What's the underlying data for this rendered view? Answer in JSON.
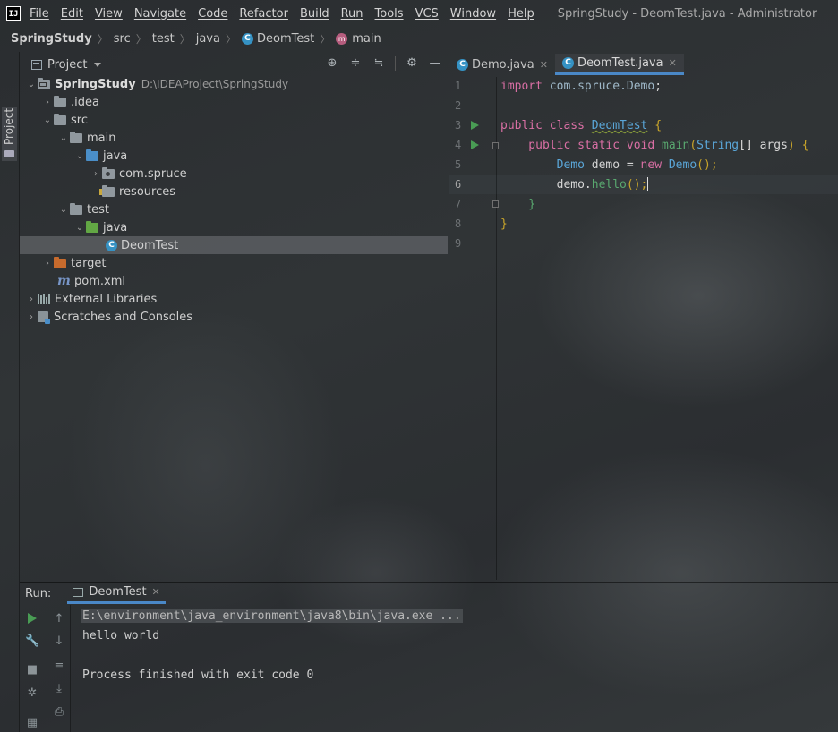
{
  "app": {
    "logo": "IJ",
    "window_title": "SpringStudy - DeomTest.java - Administrator"
  },
  "menu": [
    "File",
    "Edit",
    "View",
    "Navigate",
    "Code",
    "Refactor",
    "Build",
    "Run",
    "Tools",
    "VCS",
    "Window",
    "Help"
  ],
  "breadcrumb": {
    "project": "SpringStudy",
    "parts": [
      "src",
      "test",
      "java"
    ],
    "class": "DeomTest",
    "method": "main"
  },
  "left_stripe": {
    "label": "Project"
  },
  "project_panel": {
    "title": "Project",
    "tree": [
      {
        "label": "SpringStudy",
        "path": "D:\\IDEAProject\\SpringStudy"
      },
      {
        "label": ".idea"
      },
      {
        "label": "src"
      },
      {
        "label": "main"
      },
      {
        "label": "java"
      },
      {
        "label": "com.spruce"
      },
      {
        "label": "resources"
      },
      {
        "label": "test"
      },
      {
        "label": "java"
      },
      {
        "label": "DeomTest"
      },
      {
        "label": "target"
      },
      {
        "label": "pom.xml"
      },
      {
        "label": "External Libraries"
      },
      {
        "label": "Scratches and Consoles"
      }
    ]
  },
  "editor": {
    "tabs": [
      {
        "label": "Demo.java",
        "active": false
      },
      {
        "label": "DeomTest.java",
        "active": true
      }
    ],
    "line_numbers": [
      "1",
      "2",
      "3",
      "4",
      "5",
      "6",
      "7",
      "8",
      "9"
    ],
    "current_line": 6,
    "code": {
      "l1_kw": "import ",
      "l1_pkg": "com.spruce.Demo",
      "l1_semi": ";",
      "l3_kw": "public class ",
      "l3_name": "DeomTest",
      "l3_brace": " {",
      "l4_kw": "    public static void ",
      "l4_fn": "main",
      "l4_paren": "(",
      "l4_type": "String",
      "l4_args": "[] args",
      "l4_close": ") {",
      "l5_type": "        Demo",
      "l5_var": " demo = ",
      "l5_new": "new ",
      "l5_ctor": "Demo",
      "l5_end": "();",
      "l6_var": "        demo.",
      "l6_fn": "hello",
      "l6_end": "();",
      "l7": "    }",
      "l8": "}"
    }
  },
  "run_panel": {
    "label": "Run:",
    "tab": "DeomTest",
    "console": [
      "E:\\environment\\java_environment\\java8\\bin\\java.exe ...",
      "hello world",
      "",
      "Process finished with exit code 0"
    ]
  },
  "colors": {
    "accent": "#4a88c7",
    "run_green": "#499c54",
    "keyword": "#d96fa4",
    "type": "#5aa6d8"
  }
}
